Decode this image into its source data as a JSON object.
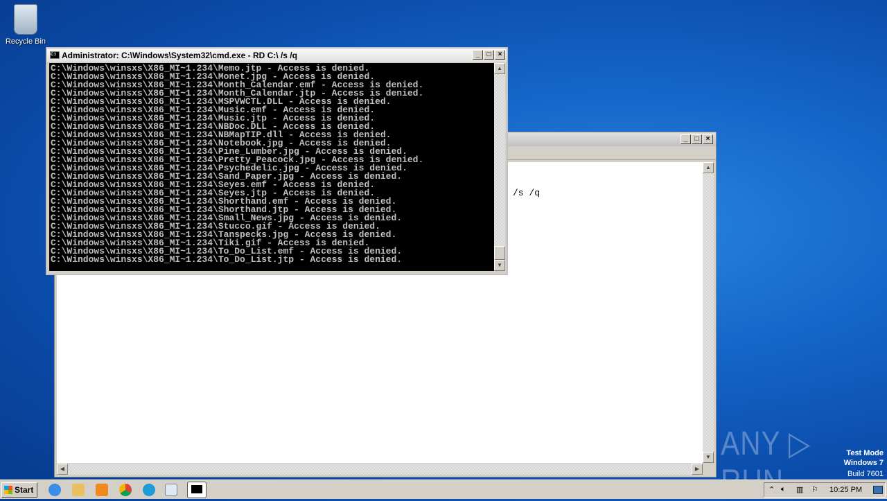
{
  "desktop": {
    "recycle_bin": "Recycle Bin"
  },
  "background_window": {
    "text": "/s /q"
  },
  "cmd": {
    "title": "Administrator: C:\\Windows\\System32\\cmd.exe - RD  C:\\ /s /q",
    "lines": [
      "C:\\Windows\\winsxs\\X86_MI~1.234\\Memo.jtp - Access is denied.",
      "C:\\Windows\\winsxs\\X86_MI~1.234\\Monet.jpg - Access is denied.",
      "C:\\Windows\\winsxs\\X86_MI~1.234\\Month_Calendar.emf - Access is denied.",
      "C:\\Windows\\winsxs\\X86_MI~1.234\\Month_Calendar.jtp - Access is denied.",
      "C:\\Windows\\winsxs\\X86_MI~1.234\\MSPVWCTL.DLL - Access is denied.",
      "C:\\Windows\\winsxs\\X86_MI~1.234\\Music.emf - Access is denied.",
      "C:\\Windows\\winsxs\\X86_MI~1.234\\Music.jtp - Access is denied.",
      "C:\\Windows\\winsxs\\X86_MI~1.234\\NBDoc.DLL - Access is denied.",
      "C:\\Windows\\winsxs\\X86_MI~1.234\\NBMapTIP.dll - Access is denied.",
      "C:\\Windows\\winsxs\\X86_MI~1.234\\Notebook.jpg - Access is denied.",
      "C:\\Windows\\winsxs\\X86_MI~1.234\\Pine_Lumber.jpg - Access is denied.",
      "C:\\Windows\\winsxs\\X86_MI~1.234\\Pretty_Peacock.jpg - Access is denied.",
      "C:\\Windows\\winsxs\\X86_MI~1.234\\Psychedelic.jpg - Access is denied.",
      "C:\\Windows\\winsxs\\X86_MI~1.234\\Sand_Paper.jpg - Access is denied.",
      "C:\\Windows\\winsxs\\X86_MI~1.234\\Seyes.emf - Access is denied.",
      "C:\\Windows\\winsxs\\X86_MI~1.234\\Seyes.jtp - Access is denied.",
      "C:\\Windows\\winsxs\\X86_MI~1.234\\Shorthand.emf - Access is denied.",
      "C:\\Windows\\winsxs\\X86_MI~1.234\\Shorthand.jtp - Access is denied.",
      "C:\\Windows\\winsxs\\X86_MI~1.234\\Small_News.jpg - Access is denied.",
      "C:\\Windows\\winsxs\\X86_MI~1.234\\Stucco.gif - Access is denied.",
      "C:\\Windows\\winsxs\\X86_MI~1.234\\Tanspecks.jpg - Access is denied.",
      "C:\\Windows\\winsxs\\X86_MI~1.234\\Tiki.gif - Access is denied.",
      "C:\\Windows\\winsxs\\X86_MI~1.234\\To_Do_List.emf - Access is denied.",
      "C:\\Windows\\winsxs\\X86_MI~1.234\\To_Do_List.jtp - Access is denied."
    ]
  },
  "taskbar": {
    "start": "Start",
    "clock": "10:25 PM",
    "icons": [
      "ie-icon",
      "explorer-icon",
      "media-player-icon",
      "chrome-icon",
      "edge-icon",
      "notepad-icon",
      "cmd-icon"
    ]
  },
  "watermark": {
    "logo": "ANY RUN",
    "line1": "Test Mode",
    "line2": "Windows 7",
    "line3": "Build 7601"
  }
}
